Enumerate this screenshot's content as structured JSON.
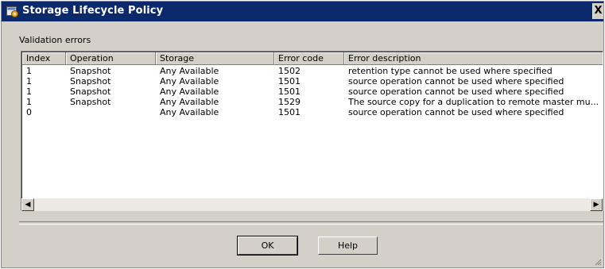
{
  "window": {
    "title": "Storage Lifecycle Policy",
    "titlebar_color": "#0c2a6b",
    "icon": "policy-app-icon",
    "close_label": "X"
  },
  "section": {
    "label": "Validation errors"
  },
  "table": {
    "columns": [
      "Index",
      "Operation",
      "Storage",
      "Error code",
      "Error description"
    ],
    "rows": [
      [
        "1",
        "Snapshot",
        "Any Available",
        "1502",
        "retention type cannot be used where specified"
      ],
      [
        "1",
        "Snapshot",
        "Any Available",
        "1501",
        "source operation cannot be used where specified"
      ],
      [
        "1",
        "Snapshot",
        "Any Available",
        "1501",
        "source operation cannot be used where specified"
      ],
      [
        "1",
        "Snapshot",
        "Any Available",
        "1529",
        "The source copy for a duplication to remote master mu..."
      ],
      [
        "0",
        "",
        "Any Available",
        "1501",
        "source operation cannot be used where specified"
      ]
    ]
  },
  "scrollbar": {
    "left_icon": "scroll-left-icon",
    "right_icon": "scroll-right-icon"
  },
  "buttons": {
    "ok": "OK",
    "help": "Help"
  }
}
